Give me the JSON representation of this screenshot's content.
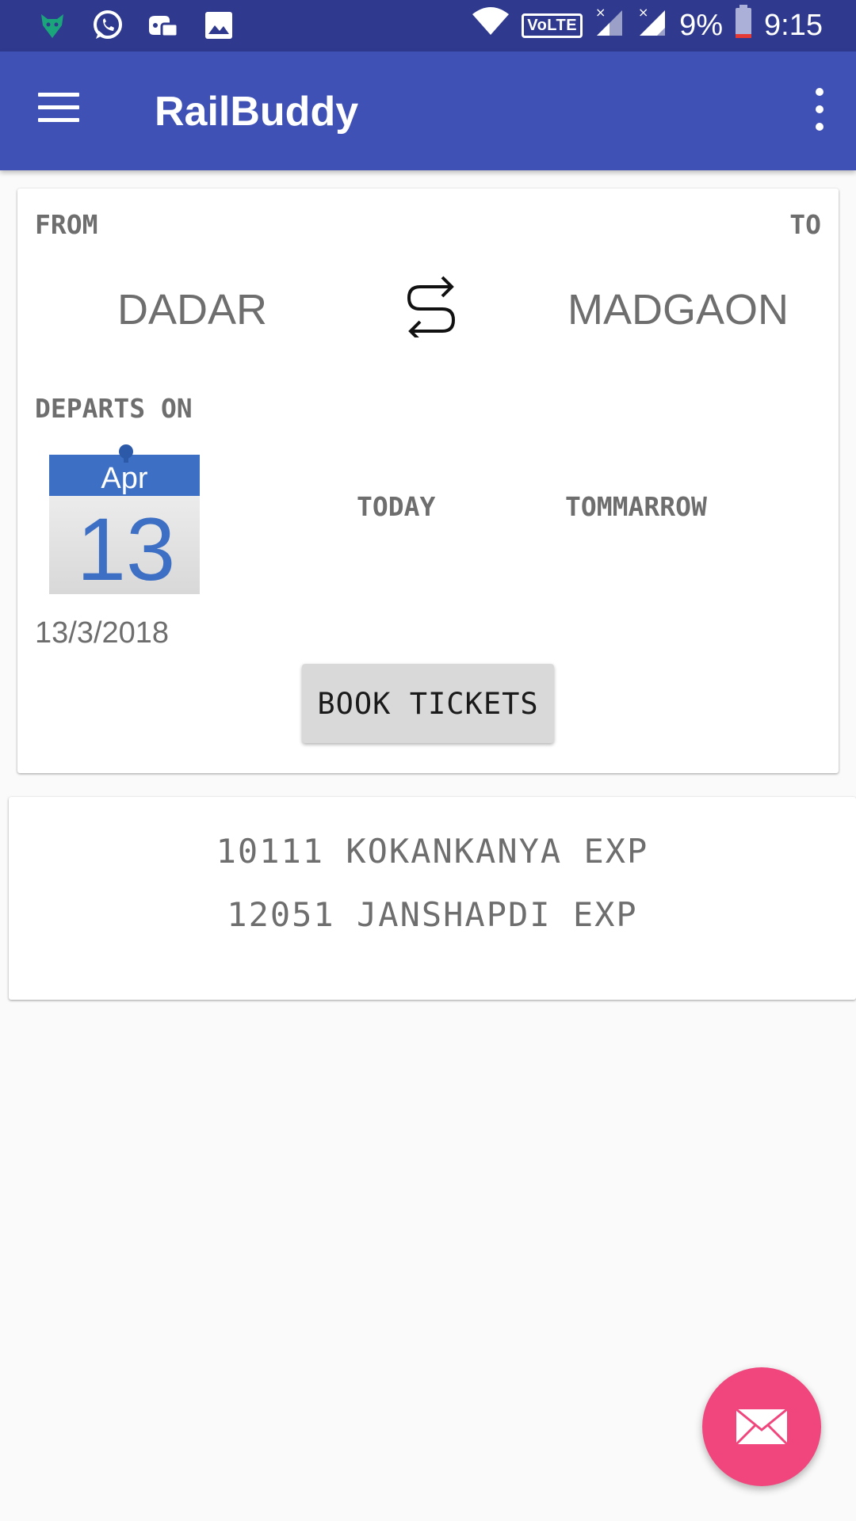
{
  "status_bar": {
    "battery": "9%",
    "time": "9:15",
    "network_label": "VoLTE",
    "left_icons": [
      "app-fox-icon",
      "whatsapp-icon",
      "game-controller-icon",
      "image-icon"
    ]
  },
  "app_bar": {
    "title": "RailBuddy"
  },
  "journey": {
    "from_label": "FROM",
    "to_label": "TO",
    "from_station": "DADAR",
    "to_station": "MADGAON",
    "departs_label": "DEPARTS ON",
    "calendar_month": "Apr",
    "calendar_day": "13",
    "today_label": "TODAY",
    "tomorrow_label": "TOMMARROW",
    "selected_date": "13/3/2018",
    "book_button": "BOOK TICKETS"
  },
  "trains": [
    "10111 KOKANKANYA EXP",
    "12051 JANSHAPDI EXP"
  ],
  "colors": {
    "status_bar": "#2f3a8f",
    "app_bar": "#3f51b5",
    "fab": "#f0467d"
  }
}
